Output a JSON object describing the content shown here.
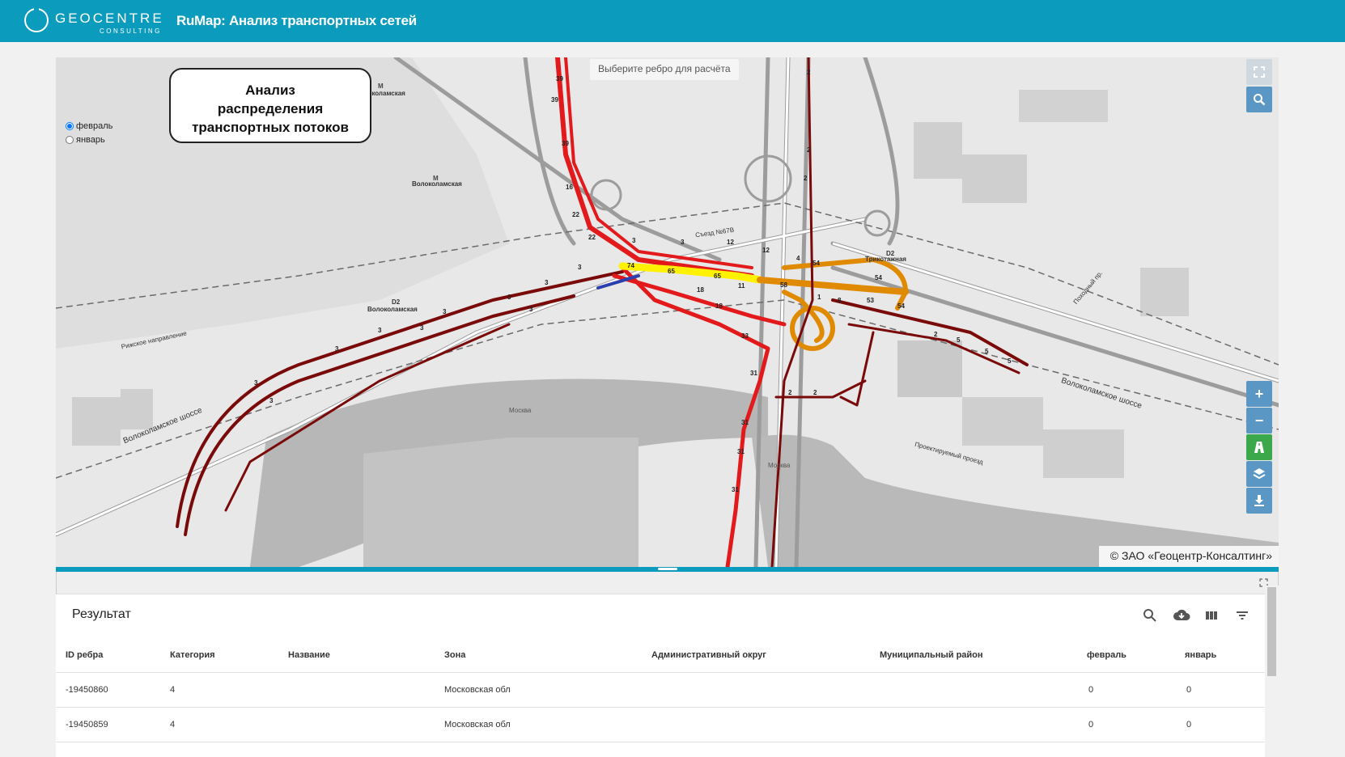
{
  "header": {
    "logo_main": "GEOCENTRE",
    "logo_sub": "CONSULTING",
    "title": "RuMap: Анализ транспортных сетей"
  },
  "map": {
    "hint": "Выберите ребро для расчёта",
    "legend_title_lines": [
      "Анализ",
      "распределения",
      "транспортных потоков"
    ],
    "period_options": [
      {
        "label": "февраль",
        "selected": true
      },
      {
        "label": "январь",
        "selected": false
      }
    ],
    "copyright": "© ЗАО «Геоцентр-Консалтинг»",
    "controls": [
      "fullscreen-icon",
      "search-icon",
      "zoom-in-icon",
      "zoom-out-icon",
      "road-icon",
      "layers-icon",
      "download-icon"
    ],
    "place_labels": [
      "Волоколамская",
      "Волоколамская",
      "Волоколамская",
      "Трикотажная",
      "Съезд №67В",
      "Москва",
      "Москва",
      "Волоколамское шоссе",
      "Волоколамское шоссе",
      "Рижское направление",
      "Проектируемый проезд",
      "Походный пр."
    ],
    "flow_labels": [
      "39",
      "39",
      "39",
      "16",
      "22",
      "22",
      "3",
      "3",
      "3",
      "3",
      "3",
      "3",
      "3",
      "3",
      "3",
      "3",
      "3",
      "3",
      "74",
      "65",
      "65",
      "18",
      "18",
      "33",
      "31",
      "31",
      "31",
      "31",
      "54",
      "54",
      "54",
      "53",
      "58",
      "12",
      "12",
      "11",
      "2",
      "2",
      "2",
      "2",
      "2",
      "5",
      "5",
      "5",
      "2",
      "4",
      "1",
      "8"
    ],
    "colors": {
      "light": "#fff200",
      "medium": "#e08a00",
      "heavy": "#e31a1c",
      "low": "#7a0a0a",
      "minor": "#2b3fae"
    }
  },
  "results": {
    "title": "Результат",
    "tool_icons": [
      "search-icon",
      "cloud-download-icon",
      "columns-icon",
      "filter-icon"
    ],
    "columns": [
      "ID ребра",
      "Категория",
      "Название",
      "Зона",
      "Административный округ",
      "Муниципальный район",
      "февраль",
      "январь"
    ],
    "rows": [
      [
        "-19450860",
        "4",
        "",
        "Московская обл",
        "",
        "",
        "0",
        "0"
      ],
      [
        "-19450859",
        "4",
        "",
        "Московская обл",
        "",
        "",
        "0",
        "0"
      ]
    ]
  }
}
